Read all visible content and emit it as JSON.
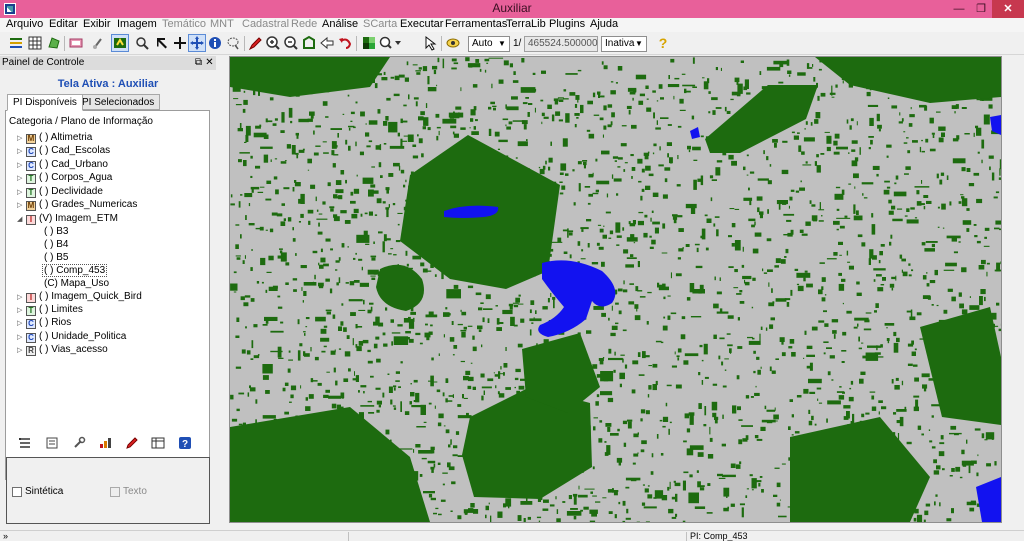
{
  "window": {
    "title": "Auxiliar"
  },
  "menu": [
    "Arquivo",
    "Editar",
    "Exibir",
    "Imagem",
    "Temático",
    "MNT",
    "Cadastral",
    "Rede",
    "Análise",
    "SCarta",
    "Executar",
    "Ferramentas",
    "TerraLib",
    "Plugins",
    "Ajuda"
  ],
  "menu_disabled": [
    "Temático",
    "MNT",
    "Cadastral",
    "Rede",
    "SCarta"
  ],
  "toolbar": {
    "zoom_mode": "Auto",
    "page_prefix": "1/",
    "scale_value": "465524.500000",
    "edit_state": "Inativa"
  },
  "panel": {
    "title": "Painel de Controle",
    "active_screen": "Tela Ativa : Auxiliar",
    "tabs": [
      "PI Disponíveis",
      "PI Selecionados"
    ],
    "tree_header": "Categoria / Plano de Informação",
    "tree": [
      {
        "expander": "▷",
        "cat": "M",
        "label": "( ) Altimetria"
      },
      {
        "expander": "▷",
        "cat": "C",
        "label": "( ) Cad_Escolas"
      },
      {
        "expander": "▷",
        "cat": "C",
        "label": "( ) Cad_Urbano"
      },
      {
        "expander": "▷",
        "cat": "T",
        "label": "( ) Corpos_Agua"
      },
      {
        "expander": "▷",
        "cat": "T",
        "label": "( ) Declividade"
      },
      {
        "expander": "▷",
        "cat": "M",
        "label": "( ) Grades_Numericas"
      },
      {
        "expander": "◢",
        "cat": "I",
        "label": "(V) Imagem_ETM"
      },
      {
        "expander": "",
        "cat": "",
        "label": "( ) B3"
      },
      {
        "expander": "",
        "cat": "",
        "label": "( ) B4"
      },
      {
        "expander": "",
        "cat": "",
        "label": "( ) B5"
      },
      {
        "expander": "",
        "cat": "",
        "label": "( ) Comp_453"
      },
      {
        "expander": "",
        "cat": "",
        "label": "(C) Mapa_Uso"
      },
      {
        "expander": "▷",
        "cat": "I",
        "label": "( ) Imagem_Quick_Bird"
      },
      {
        "expander": "▷",
        "cat": "T",
        "label": "( ) Limites"
      },
      {
        "expander": "▷",
        "cat": "C",
        "label": "( ) Rios"
      },
      {
        "expander": "▷",
        "cat": "C",
        "label": "( ) Unidade_Politica"
      },
      {
        "expander": "▷",
        "cat": "R",
        "label": "( ) Vias_acesso"
      }
    ],
    "checkboxes": {
      "synthetic": "Sintética",
      "text": "Texto"
    }
  },
  "map": {
    "colors": {
      "background": "#c0c0c0",
      "vegetation": "#1d6b0f",
      "water": "#1212f0"
    }
  },
  "status": {
    "corner": "»",
    "pi": "PI: Comp_453"
  },
  "icons": [
    "layers-icon",
    "grid-icon",
    "draw-polygon-icon",
    "eraser-icon",
    "clip-icon",
    "select-tool-icon",
    "zoom-icon",
    "move-icon",
    "add-icon",
    "pan-icon",
    "info-icon",
    "lasso-icon",
    "pencil-icon",
    "zoom-in-icon",
    "zoom-out-icon",
    "zoom-area-icon",
    "back-icon",
    "undo-icon",
    "color-icon",
    "zoom-dropdown-icon",
    "pointer-icon",
    "eye-icon",
    "help-icon"
  ]
}
